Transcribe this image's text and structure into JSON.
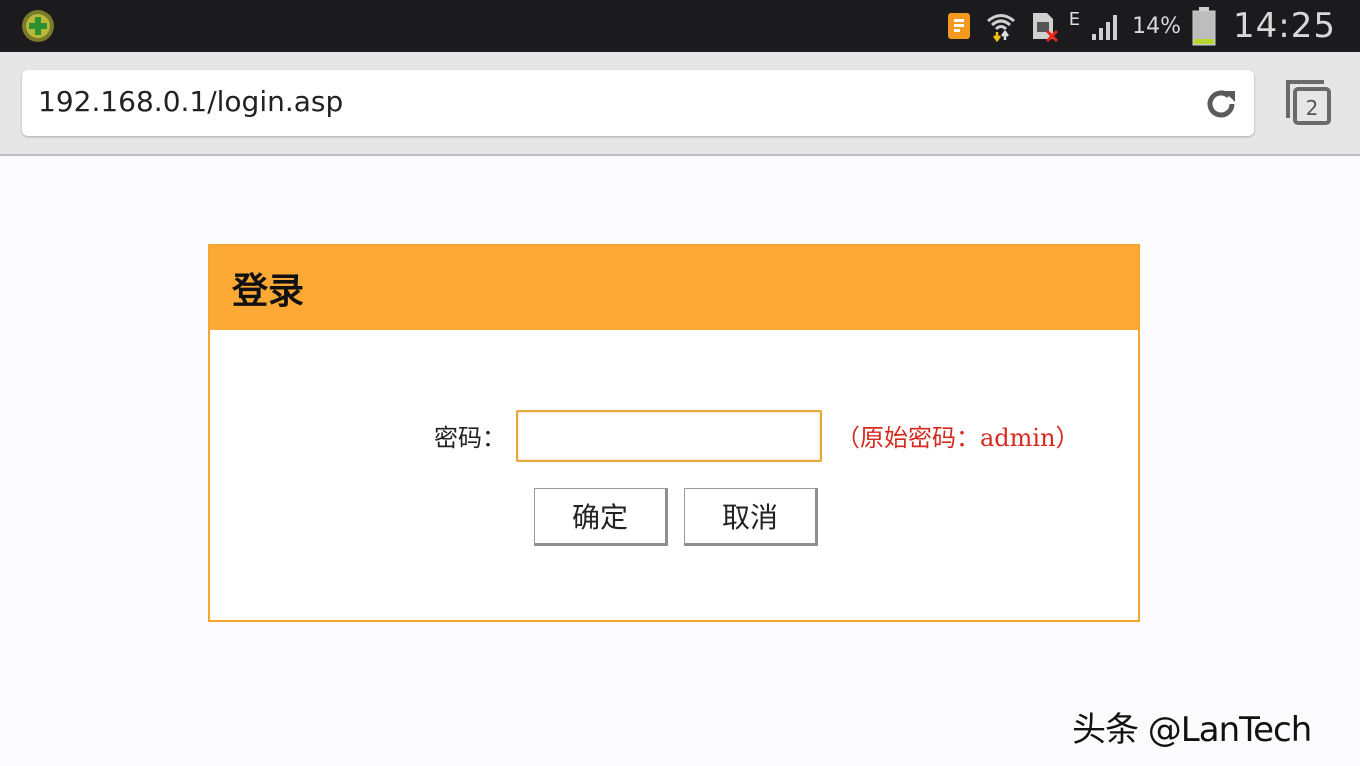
{
  "status_bar": {
    "left_app_icon": "app-shortcut-icon",
    "icons": [
      "notification-icon",
      "wifi-icon",
      "sim-icon",
      "signal-icon",
      "battery-icon"
    ],
    "network_type": "E",
    "battery_percent": "14%",
    "time": "14:25"
  },
  "browser": {
    "url": "192.168.0.1/login.asp",
    "reload_icon": "reload-icon",
    "tab_count": "2"
  },
  "login": {
    "title": "登录",
    "password_label": "密码：",
    "password_value": "",
    "password_hint": "（原始密码：admin）",
    "ok_label": "确定",
    "cancel_label": "取消"
  },
  "watermark": {
    "text": "头条 @LanTech"
  },
  "colors": {
    "accent": "#fda936",
    "hint": "#d62a1f",
    "status_bar_bg": "#1b1b1d"
  }
}
